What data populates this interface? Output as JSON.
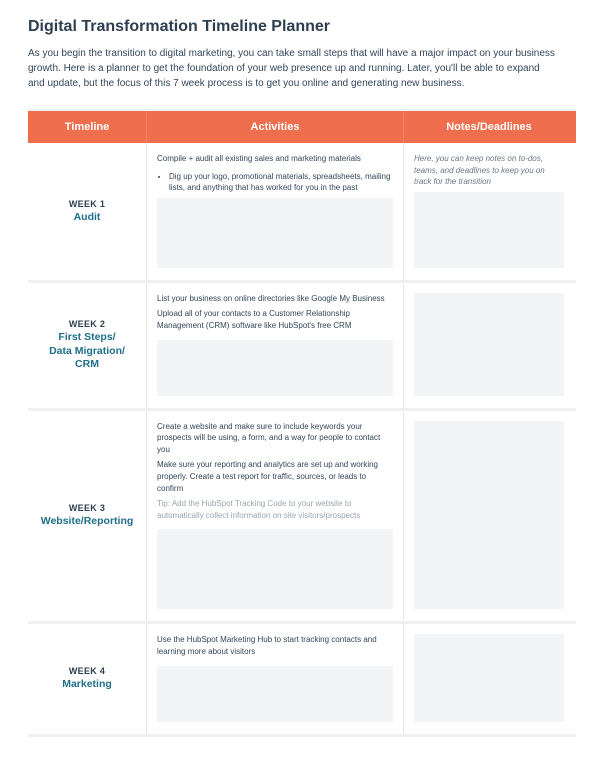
{
  "title": "Digital Transformation Timeline Planner",
  "intro": "As you begin the transition to digital marketing, you can take small steps that will have a major impact on your business growth. Here is a planner to get the foundation of your web presence up and running. Later, you'll be able to expand and update, but the focus of this 7 week process is to get you online and generating new business.",
  "header": {
    "timeline": "Timeline",
    "activities": "Activities",
    "notes": "Notes/Deadlines"
  },
  "colors": {
    "accent": "#ee6e4d",
    "heading": "#2e3f50",
    "link": "#1f6f8b"
  },
  "rows": [
    {
      "week": "WEEK 1",
      "name": "Audit",
      "activities": {
        "lead": "Compile + audit all existing sales and marketing materials",
        "bullets": [
          "Dig up your logo, promotional materials, spreadsheets, mailing lists, and anything that has worked for you in the past"
        ]
      },
      "notes": "Here, you can keep notes on to-dos, teams, and deadlines to keep you on track for the transition"
    },
    {
      "week": "WEEK 2",
      "name": "First Steps/\nData Migration/\nCRM",
      "activities": {
        "paras": [
          "List your business on online directories like Google My Business",
          "Upload all of your contacts to a Customer Relationship Management (CRM) software like HubSpot's free CRM"
        ]
      },
      "notes": ""
    },
    {
      "week": "WEEK 3",
      "name": "Website/Reporting",
      "activities": {
        "paras": [
          "Create a website and make sure to include keywords your prospects will be using, a form, and a way for people to contact you",
          "Make sure your reporting and analytics are set up and working properly. Create a test report for traffic, sources, or leads to confirm"
        ],
        "tip": "Tip: Add the HubSpot Tracking Code to your website to automatically collect information on site visitors/prospects"
      },
      "notes": ""
    },
    {
      "week": "WEEK 4",
      "name": "Marketing",
      "activities": {
        "paras": [
          "Use the HubSpot Marketing Hub to start tracking contacts and learning more about visitors"
        ]
      },
      "notes": ""
    }
  ]
}
